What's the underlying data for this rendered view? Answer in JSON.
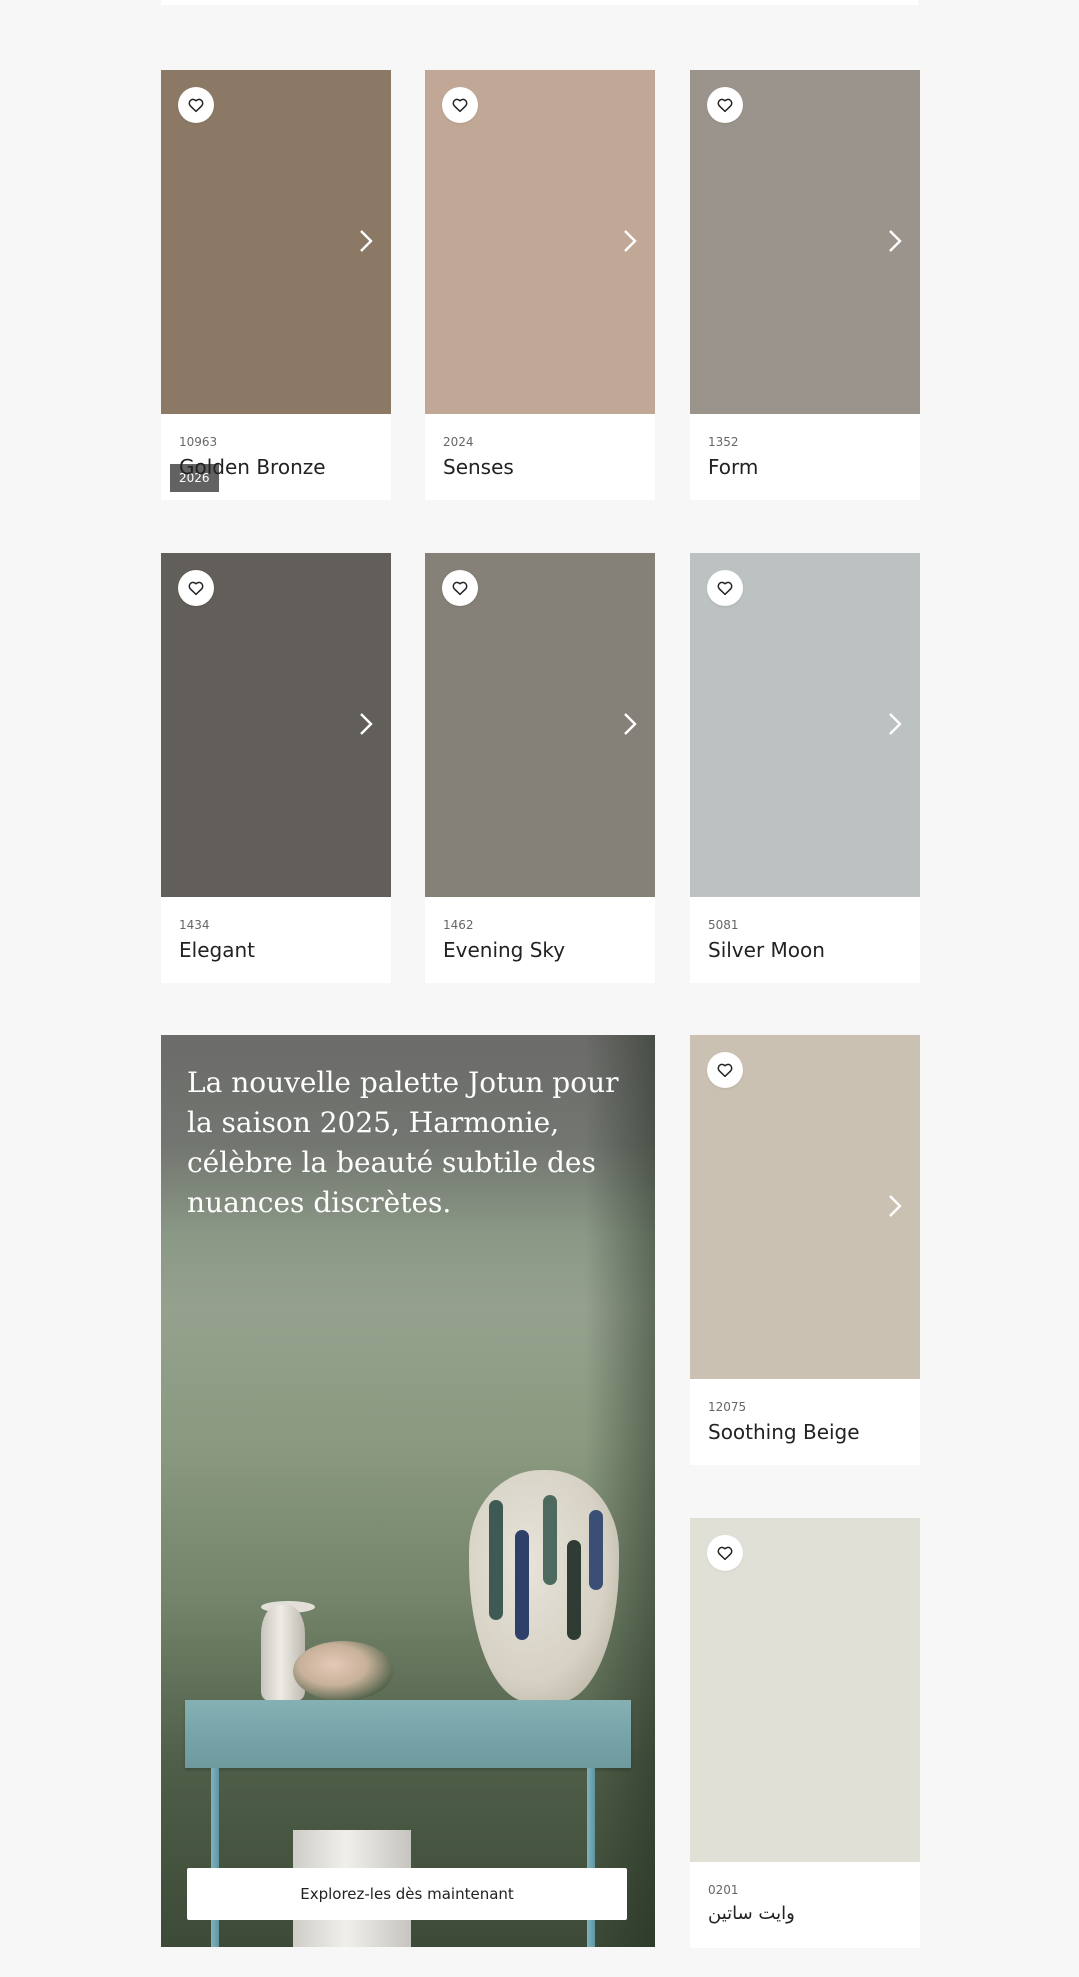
{
  "cards": [
    {
      "code": "10963",
      "name": "Golden Bronze",
      "color": "#8b7865",
      "badge": "2026"
    },
    {
      "code": "2024",
      "name": "Senses",
      "color": "#c1a796"
    },
    {
      "code": "1352",
      "name": "Form",
      "color": "#9b948c"
    },
    {
      "code": "1434",
      "name": "Elegant",
      "color": "#625f5a"
    },
    {
      "code": "1462",
      "name": "Evening Sky",
      "color": "#858179"
    },
    {
      "code": "5081",
      "name": "Silver Moon",
      "color": "#bcc2c1"
    },
    {
      "code": "12075",
      "name": "Soothing Beige",
      "color": "#cbc1b2"
    },
    {
      "code": "0201",
      "name": "وايت ساتين",
      "color": "#e1e0d7"
    }
  ],
  "icons": {
    "favorite": "heart-outline-icon",
    "next": "chevron-right-icon"
  },
  "promo": {
    "headline": "La nouvelle palette Jotun pour la saison 2025, Harmonie, célèbre la beauté subtile des nuances discrètes.",
    "cta_label": "Explorez-les dès maintenant"
  }
}
